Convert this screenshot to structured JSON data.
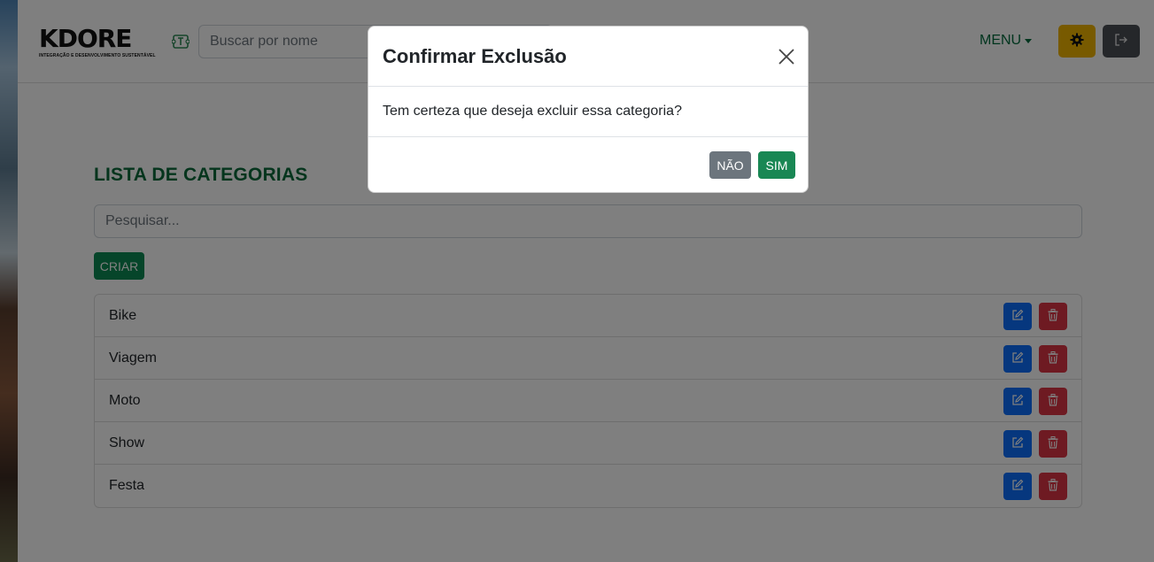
{
  "navbar": {
    "logo_text": "KDORE",
    "logo_subtitle": "INTEGRAÇÃO E DESENVOLVIMENTO SUSTENTÁVEL",
    "search_placeholder": "Buscar por nome",
    "menu_label": "MENU",
    "icons": {
      "search": "ticket-icon",
      "settings": "gear-icon",
      "logout": "logout-icon"
    }
  },
  "main": {
    "title": "LISTA DE CATEGORIAS",
    "search_placeholder": "Pesquisar...",
    "create_label": "CRIAR",
    "categories": [
      "Bike",
      "Viagem",
      "Moto",
      "Show",
      "Festa"
    ]
  },
  "modal": {
    "title": "Confirmar Exclusão",
    "message": "Tem certeza que deseja excluir essa categoria?",
    "no_label": "NÃO",
    "yes_label": "SIM"
  },
  "colors": {
    "brand_green": "#0a6b3a",
    "edit_blue": "#0d6efd",
    "delete_red": "#dc3545",
    "settings_yellow": "#f0b400"
  }
}
